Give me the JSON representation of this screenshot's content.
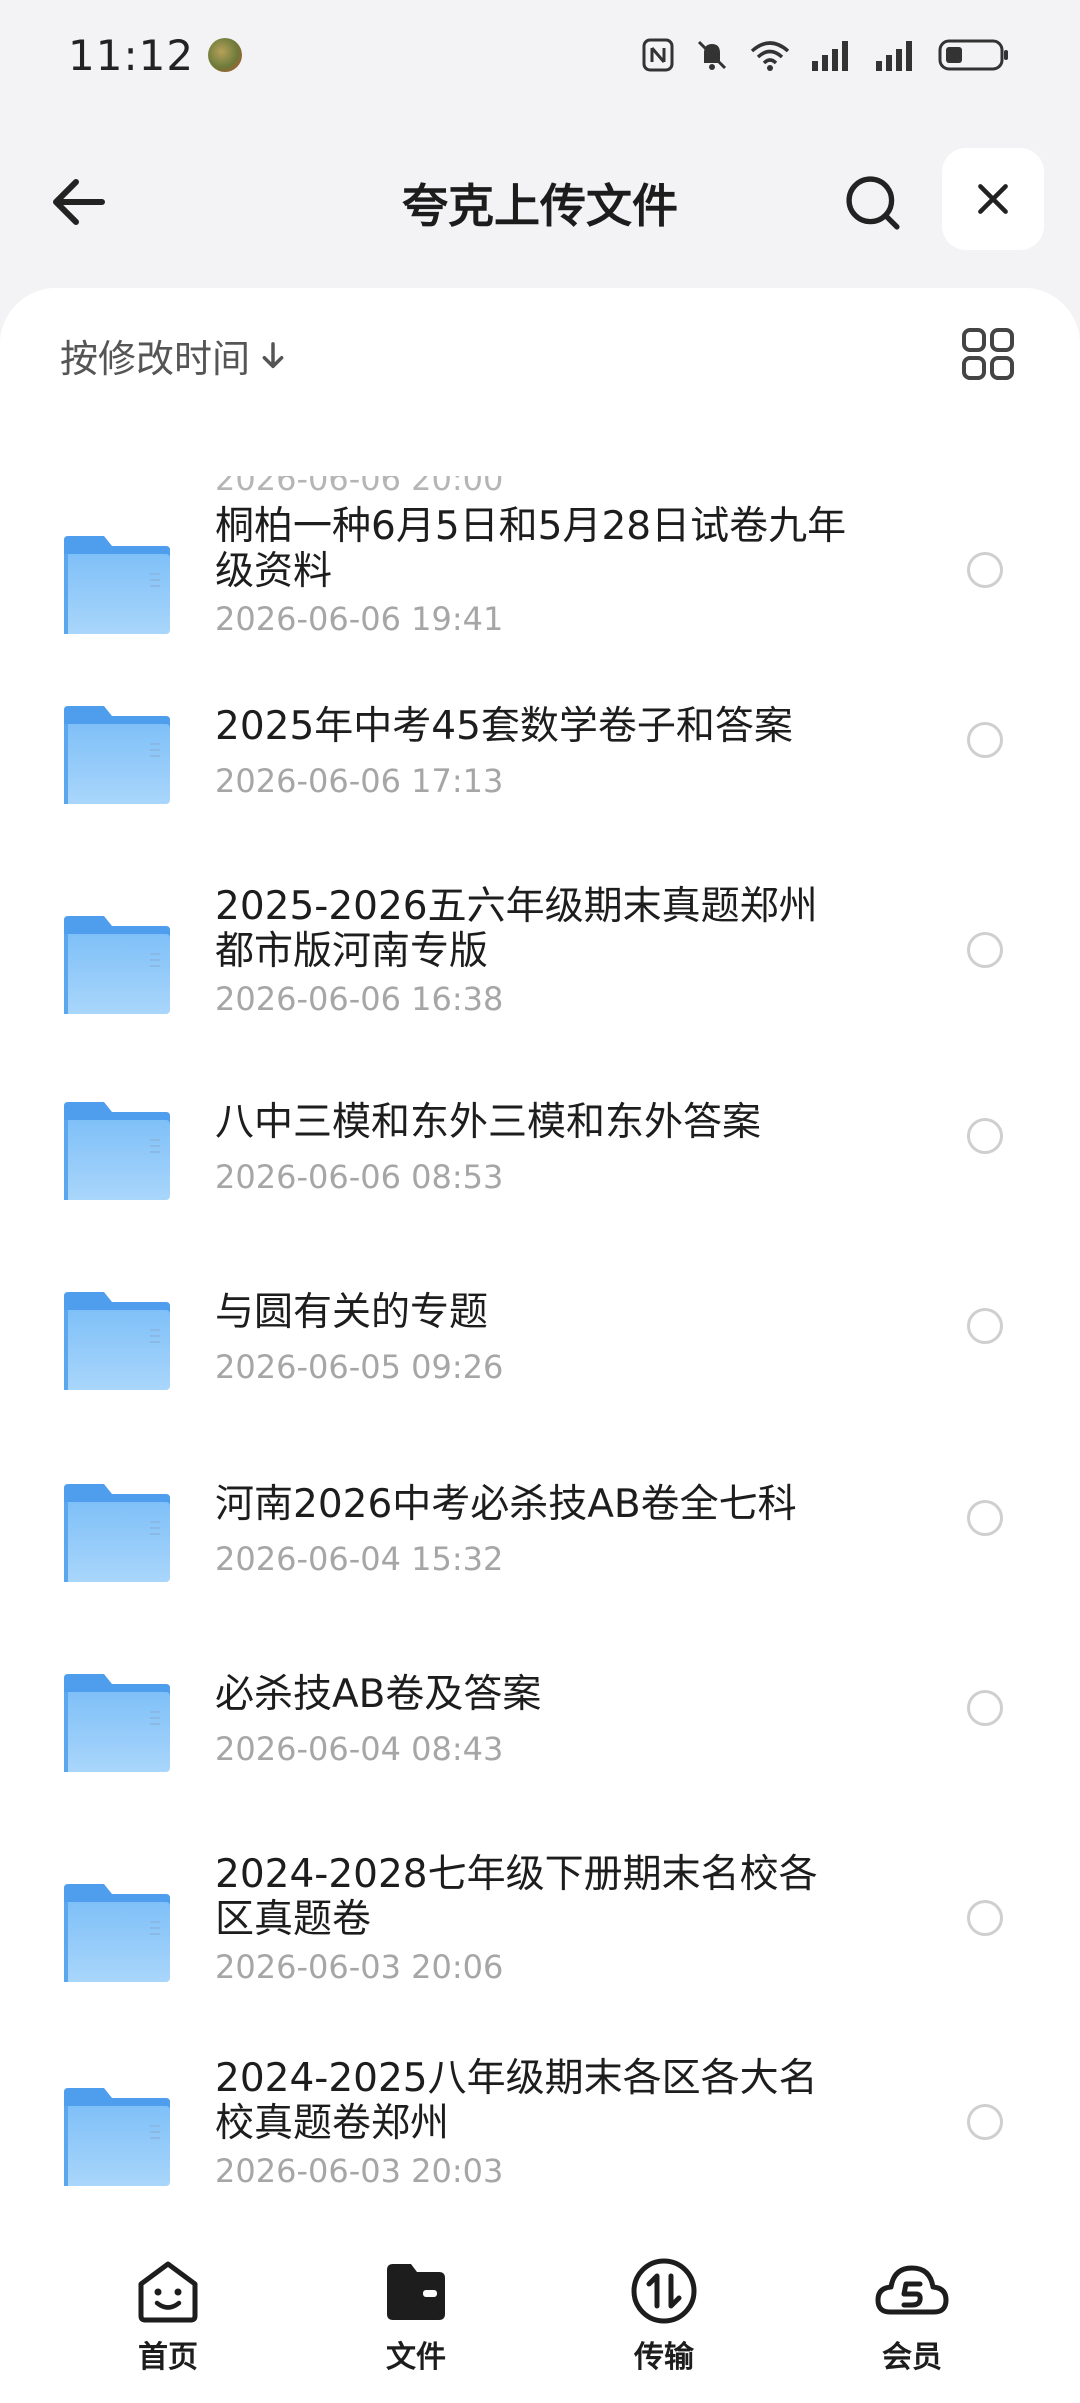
{
  "status_bar": {
    "time": "11:12"
  },
  "header": {
    "title": "夸克上传文件"
  },
  "sort": {
    "label": "按修改时间"
  },
  "list": {
    "partial_top_date": "2026-06-06 20:00",
    "items": [
      {
        "name": "桐柏一种6月5日和5月28日试卷九年级资料",
        "date": "2026-06-06 19:41"
      },
      {
        "name": "2025年中考45套数学卷子和答案",
        "date": "2026-06-06 17:13"
      },
      {
        "name": "2025-2026五六年级期末真题郑州都市版河南专版",
        "date": "2026-06-06 16:38"
      },
      {
        "name": "八中三模和东外三模和东外答案",
        "date": "2026-06-06 08:53"
      },
      {
        "name": "与圆有关的专题",
        "date": "2026-06-05 09:26"
      },
      {
        "name": "河南2026中考必杀技AB卷全七科",
        "date": "2026-06-04 15:32"
      },
      {
        "name": "必杀技AB卷及答案",
        "date": "2026-06-04 08:43"
      },
      {
        "name": "2024-2028七年级下册期末名校各区真题卷",
        "date": "2026-06-03 20:06"
      },
      {
        "name": "2024-2025八年级期末各区各大名校真题卷郑州",
        "date": "2026-06-03 20:03"
      }
    ]
  },
  "bottom_nav": {
    "items": [
      {
        "label": "首页",
        "icon": "home-face-icon"
      },
      {
        "label": "文件",
        "icon": "folder-icon"
      },
      {
        "label": "传输",
        "icon": "transfer-icon"
      },
      {
        "label": "会员",
        "icon": "vip-cloud-icon"
      }
    ]
  },
  "colors": {
    "folder_blue": "#6fb4f5",
    "accent": "#1d1d1d"
  }
}
